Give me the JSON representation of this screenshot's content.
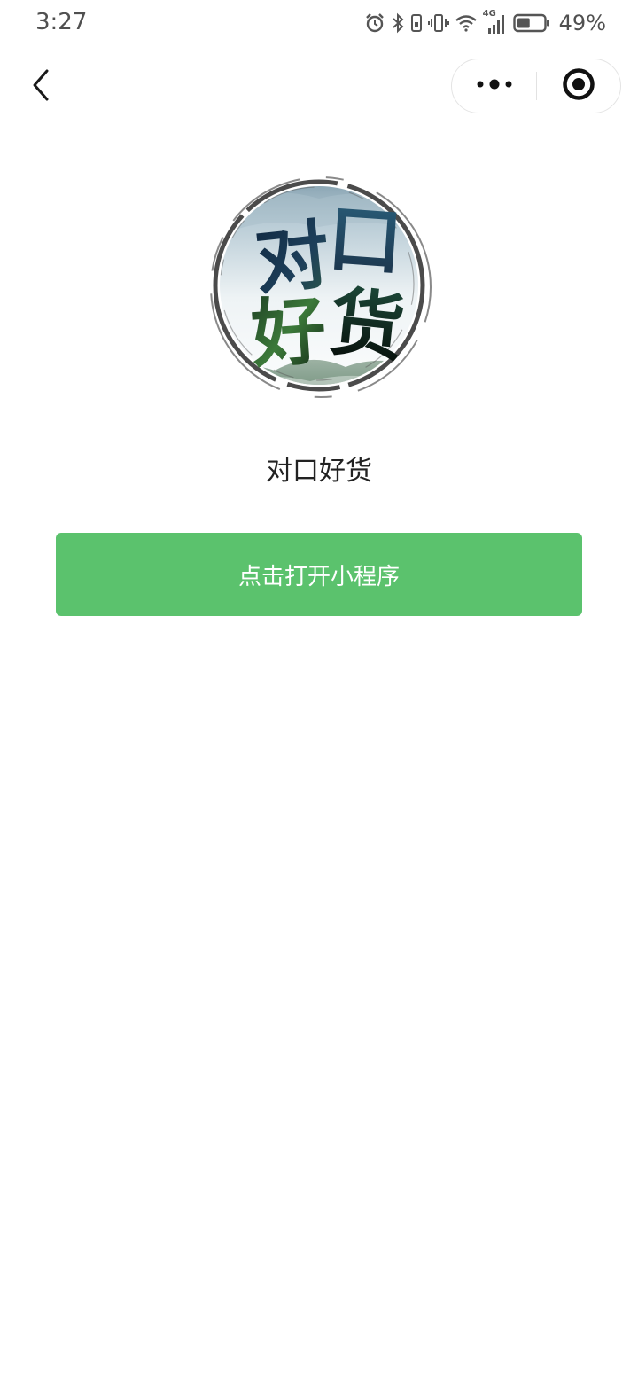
{
  "status_bar": {
    "time": "3:27",
    "battery_percent": "49%",
    "network_label": "4G",
    "icons": [
      "alarm-icon",
      "bluetooth-icon",
      "sim-icon",
      "vibrate-icon",
      "wifi-icon",
      "signal-icon",
      "battery-icon"
    ],
    "battery_level": 0.49
  },
  "nav": {
    "back_icon": "chevron-left-icon",
    "more_icon": "more-dots-icon",
    "close_icon": "target-close-icon"
  },
  "app": {
    "logo_chars": [
      "对",
      "口",
      "好",
      "货"
    ],
    "name": "对口好货"
  },
  "action": {
    "open_label": "点击打开小程序",
    "accent_color": "#5bc26d"
  }
}
